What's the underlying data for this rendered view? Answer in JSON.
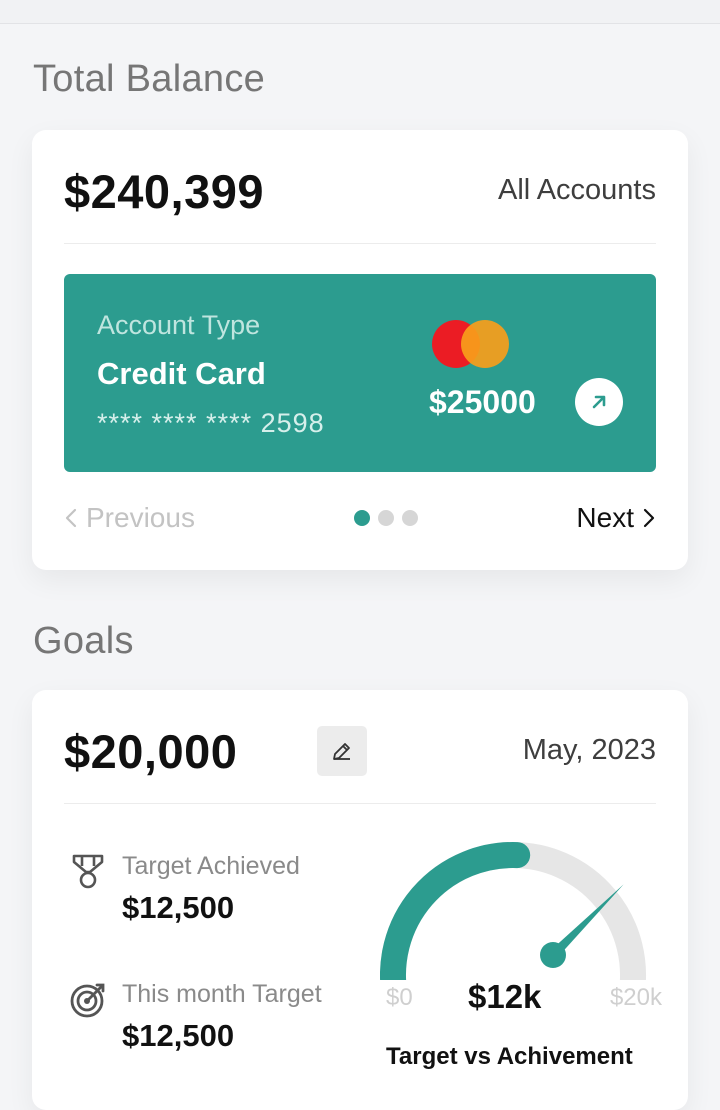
{
  "total_balance": {
    "section_title": "Total Balance",
    "amount": "$240,399",
    "accounts_label": "All Accounts",
    "account_card": {
      "type_label": "Account Type",
      "name": "Credit Card",
      "masked_number": "**** **** **** 2598",
      "amount": "$25000",
      "brand_icon": "mastercard-logo",
      "action_icon": "arrow-up-right-icon",
      "color": "#2c9c8f"
    },
    "pager": {
      "previous_label": "Previous",
      "next_label": "Next",
      "page_count": 3,
      "active_index": 0
    }
  },
  "goals": {
    "section_title": "Goals",
    "amount": "$20,000",
    "edit_icon": "pencil-icon",
    "period": "May, 2023",
    "stats": [
      {
        "icon": "medal-icon",
        "label": "Target Achieved",
        "value": "$12,500"
      },
      {
        "icon": "target-icon",
        "label": "This month Target",
        "value": "$12,500"
      }
    ],
    "gauge": {
      "min_label": "$0",
      "max_label": "$20k",
      "value_label": "$12k",
      "fraction": 0.6,
      "caption": "Target vs Achivement",
      "fill_color": "#2c9c8f",
      "track_color": "#e6e6e6"
    }
  }
}
